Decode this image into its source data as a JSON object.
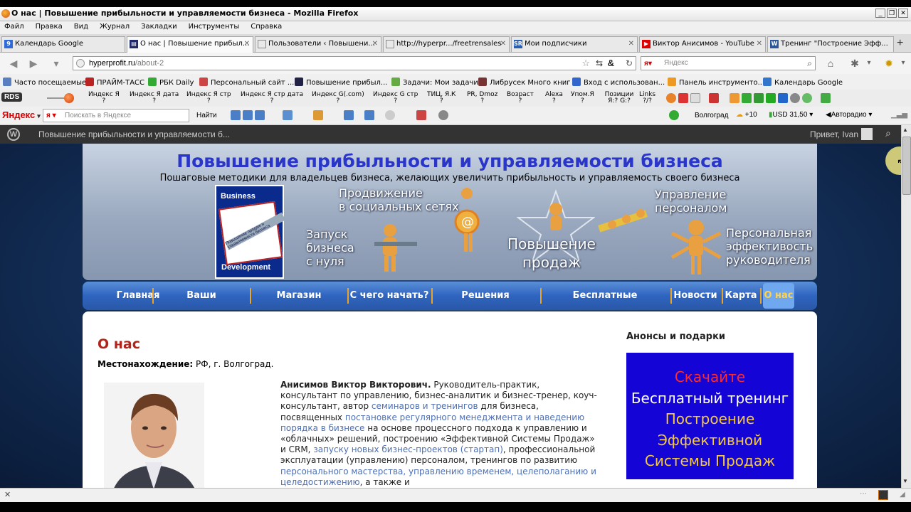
{
  "window": {
    "title": "О нас | Повышение прибыльности и управляемости бизнеса - Mozilla Firefox"
  },
  "menu": [
    "Файл",
    "Правка",
    "Вид",
    "Журнал",
    "Закладки",
    "Инструменты",
    "Справка"
  ],
  "tabs": [
    {
      "label": "Календарь Google",
      "icon": "google-calendar-icon"
    },
    {
      "label": "О нас | Повышение прибыл...",
      "icon": "site-icon",
      "active": true
    },
    {
      "label": "Пользователи ‹ Повышени...",
      "icon": "page-icon"
    },
    {
      "label": "http://hyperpr.../freetrensales",
      "icon": "page-icon"
    },
    {
      "label": "Мои подписчики",
      "icon": "smartresponder-icon"
    },
    {
      "label": "Виктор Анисимов - YouTube",
      "icon": "youtube-icon"
    },
    {
      "label": "Тренинг \"Построение Эфф...",
      "icon": "word-icon"
    }
  ],
  "address": {
    "host": "hyperprofit.ru",
    "path": "/about-2",
    "search_placeholder": "Яндекс"
  },
  "bookmarks": [
    {
      "label": "Часто посещаемые",
      "color": "#5a7fc0"
    },
    {
      "label": "ПРАЙМ-ТАСС",
      "color": "#b22"
    },
    {
      "label": "РБК Daily",
      "color": "#3a3"
    },
    {
      "label": "Персональный сайт ...",
      "color": "#c44"
    },
    {
      "label": "Повышение прибыл...",
      "color": "#224"
    },
    {
      "label": "Задачи: Мои задачи",
      "color": "#6a4"
    },
    {
      "label": "Либрусек Много книг",
      "color": "#733"
    },
    {
      "label": "Вход с использован...",
      "color": "#36c"
    },
    {
      "label": "Панель инструменто...",
      "color": "#e92"
    },
    {
      "label": "Календарь Google",
      "color": "#37c"
    }
  ],
  "rds": {
    "label": "RDS",
    "items": [
      {
        "name": "Индекс Я",
        "val": "?"
      },
      {
        "name": "Индекс Я дата",
        "val": "?"
      },
      {
        "name": "Индекс Я стр",
        "val": "?"
      },
      {
        "name": "Индекс Я стр дата",
        "val": "?"
      },
      {
        "name": "Индекс G(.com)",
        "val": "?"
      },
      {
        "name": "Индекс G стр",
        "val": "?"
      },
      {
        "name": "ТИЦ, Я.К",
        "val": "?"
      },
      {
        "name": "PR, Dmoz",
        "val": "?"
      },
      {
        "name": "Возраст",
        "val": "?"
      },
      {
        "name": "Alexa",
        "val": "?"
      },
      {
        "name": "Упом.Я",
        "val": "?"
      },
      {
        "name": "Позиции Я:? G:?",
        "val": ""
      },
      {
        "name": "Links",
        "val": "?/?"
      }
    ]
  },
  "yandexbar": {
    "logo": "Яндекс",
    "search_placeholder": "Поискать в Яндексе",
    "find_label": "Найти",
    "city": "Волгоград",
    "weather": "+10",
    "currency": "USD 31,50",
    "radio": "Авторадио"
  },
  "wpadmin": {
    "site_title": "Повышение прибыльности и управляемости б...",
    "greeting": "Привет, Ivan"
  },
  "header": {
    "title": "Повышение прибыльности и управляемости бизнеса",
    "description": "Пошаговые методики для владельцев бизнеса, желающих увеличить прибыльность и управляемость своего бизнеса",
    "book": {
      "top": "Business",
      "bottom": "Development",
      "middle": "Повышение продаж и управляемости бизнеса"
    },
    "labels": {
      "social": "Продвижение\nв социальных сетях",
      "startup": "Запуск\nбизнеса\nс нуля",
      "sales": "Повышение\nпродаж",
      "staff": "Управление\nперсоналом",
      "personal": "Персональная\nэффективость\nруководителя"
    }
  },
  "nav": [
    "Главная",
    "Ваши результаты",
    "Магазин решений",
    "С чего начать?",
    "Решения партнеров",
    "Бесплатные материалы",
    "Новости",
    "Карта",
    "О нас"
  ],
  "page": {
    "heading": "О нас",
    "location_label": "Местонахождение:",
    "location_value": " РФ,  г. Волгоград.",
    "bio_name": "Анисимов Виктор Викторович.",
    "bio_1": " Руководитель-практик, консультант по управлению, бизнес-аналитик и бизнес-тренер, коуч-консультант, автор ",
    "bio_link_1": "семинаров и тренингов",
    "bio_2": " для бизнеса, посвященных ",
    "bio_link_2": "постановке регулярного менеджмента и наведению порядка в бизнесе",
    "bio_3": " на основе процессного подхода к управлению и «облачных» решений, построению «Эффективной Системы Продаж» и CRM, ",
    "bio_link_3": "запуску новых бизнес-проектов (стартап)",
    "bio_4": ", профессиональной эксплуатации (управлению) персоналом, тренингов по развитию ",
    "bio_link_4": "персонального мастерства, управлению временем, целеполаганию и целедостижению",
    "bio_5": ", а также и"
  },
  "sidebar": {
    "title": "Анонсы и подарки",
    "promo": [
      {
        "text": "Скачайте",
        "color": "#ff2a2a"
      },
      {
        "text": "Бесплатный тренинг",
        "color": "#ffffff"
      },
      {
        "text": "Построение",
        "color": "#f5c842"
      },
      {
        "text": "Эффективной",
        "color": "#f5c842"
      },
      {
        "text": "Системы Продаж",
        "color": "#f5c842"
      }
    ]
  }
}
